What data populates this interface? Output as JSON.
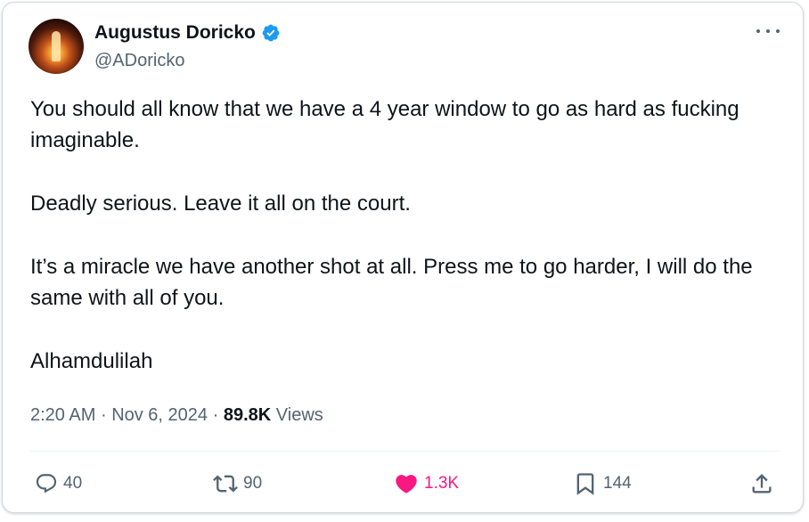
{
  "tweet": {
    "author": {
      "display_name": "Augustus Doricko",
      "handle": "@ADoricko",
      "verified": true,
      "verified_color": "#1d9bf0"
    },
    "text_paragraphs": [
      "You should all know that we have a 4 year window to go as hard as fucking imaginable.",
      "Deadly serious. Leave it all on the court.",
      "It’s a miracle we have another shot at all. Press me to go harder, I will do the same with all of you.",
      "Alhamdulilah"
    ],
    "time": "2:20 AM",
    "separator": "·",
    "date": "Nov 6, 2024",
    "views_count": "89.8K",
    "views_label": "Views"
  },
  "actions": {
    "reply": {
      "icon": "reply-icon",
      "count": "40"
    },
    "retweet": {
      "icon": "retweet-icon",
      "count": "90"
    },
    "like": {
      "icon": "heart-icon",
      "count": "1.3K",
      "liked": true,
      "color": "#f91880"
    },
    "bookmark": {
      "icon": "bookmark-icon",
      "count": "144"
    },
    "share": {
      "icon": "share-icon"
    }
  },
  "colors": {
    "text": "#0f1419",
    "secondary": "#536471",
    "border": "#cfd9de"
  }
}
